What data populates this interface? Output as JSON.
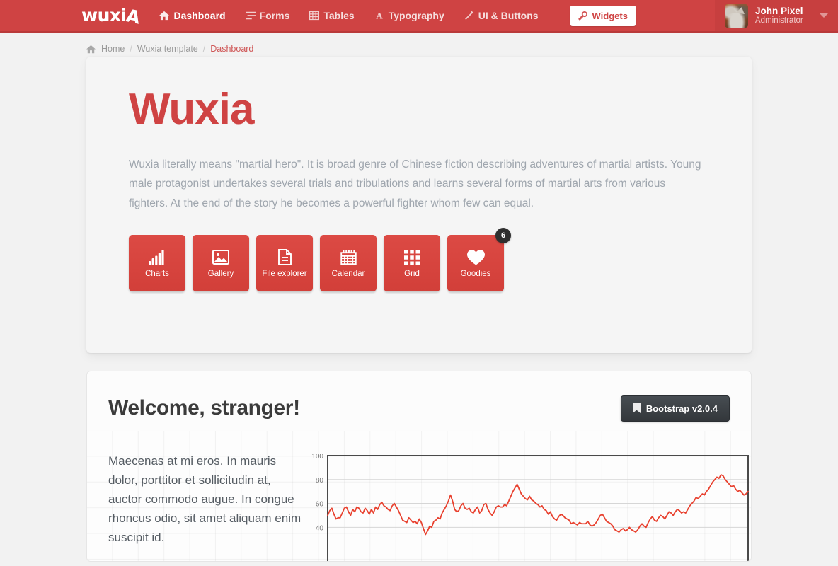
{
  "colors": {
    "brand_red": "#cf4343",
    "tile_red": "#d9453f",
    "page_bg": "#f2f2f2",
    "panel_bg": "#f5f5f5",
    "dark_btn": "#3a3f44",
    "chart_line": "#e8412f",
    "muted_text": "#9fa6ae"
  },
  "navbar": {
    "brand": "wuxia",
    "items": [
      {
        "label": "Dashboard",
        "icon": "home-icon",
        "active": true
      },
      {
        "label": "Forms",
        "icon": "list-icon",
        "active": false
      },
      {
        "label": "Tables",
        "icon": "table-icon",
        "active": false
      },
      {
        "label": "Typography",
        "icon": "font-icon",
        "active": false
      },
      {
        "label": "UI & Buttons",
        "icon": "magic-wand-icon",
        "active": false
      }
    ],
    "widgets_label": "Widgets",
    "widgets_icon": "wrench-icon",
    "user": {
      "name": "John Pixel",
      "role": "Administrator",
      "avatar_alt": "cat-avatar",
      "caret_icon": "caret-down-icon"
    }
  },
  "breadcrumb": {
    "home_icon": "home-icon",
    "items": [
      {
        "label": "Home",
        "current": false
      },
      {
        "label": "Wuxia template",
        "current": false
      },
      {
        "label": "Dashboard",
        "current": true
      }
    ],
    "separator": "/"
  },
  "hero": {
    "title": "Wuxia",
    "paragraph": "Wuxia literally means \"martial hero\". It is broad genre of Chinese fiction describing adventures of martial artists. Young male protagonist undertakes several trials and tribulations and learns several forms of martial arts from various fighters. At the end of the story he becomes a powerful fighter whom few can equal.",
    "tiles": [
      {
        "label": "Charts",
        "icon": "bar-chart-icon",
        "badge": null
      },
      {
        "label": "Gallery",
        "icon": "image-icon",
        "badge": null
      },
      {
        "label": "File explorer",
        "icon": "file-icon",
        "badge": null
      },
      {
        "label": "Calendar",
        "icon": "calendar-icon",
        "badge": null
      },
      {
        "label": "Grid",
        "icon": "grid-icon",
        "badge": null
      },
      {
        "label": "Goodies",
        "icon": "heart-icon",
        "badge": "6"
      }
    ]
  },
  "welcome": {
    "title": "Welcome, stranger!",
    "badge_button": {
      "label": "Bootstrap v2.0.4",
      "icon": "bookmark-icon"
    },
    "paragraph": "Maecenas at mi eros. In mauris dolor, porttitor et sollicitudin at, auctor commodo augue. In congue rhoncus odio, sit amet aliquam enim suscipit id."
  },
  "chart_data": {
    "type": "line",
    "title": "",
    "xlabel": "",
    "ylabel": "",
    "ylim": [
      0,
      100
    ],
    "yticks": [
      40,
      60,
      80,
      100
    ],
    "ytick_labels": [
      "40",
      "60",
      "80",
      "100"
    ],
    "grid": true,
    "legend": false,
    "series": [
      {
        "name": "series-1",
        "color": "#e8412f",
        "values": [
          50,
          54,
          56,
          51,
          47,
          48,
          48,
          52,
          56,
          57,
          53,
          50,
          55,
          53,
          57,
          56,
          53,
          52,
          56,
          54,
          51,
          55,
          52,
          57,
          55,
          59,
          61,
          58,
          57,
          55,
          54,
          58,
          60,
          57,
          54,
          50,
          46,
          45,
          44,
          48,
          46,
          44,
          45,
          43,
          47,
          44,
          39,
          34,
          37,
          41,
          40,
          45,
          46,
          48,
          47,
          52,
          55,
          58,
          62,
          67,
          62,
          55,
          53,
          54,
          58,
          60,
          56,
          55,
          56,
          53,
          52,
          55,
          57,
          52,
          54,
          59,
          60,
          55,
          52,
          50,
          53,
          57,
          58,
          57,
          57,
          59,
          58,
          62,
          66,
          70,
          73,
          76,
          72,
          68,
          66,
          64,
          63,
          66,
          63,
          62,
          60,
          59,
          57,
          58,
          55,
          54,
          51,
          53,
          49,
          47,
          46,
          49,
          51,
          50,
          48,
          47,
          46,
          43,
          44,
          43,
          42,
          44,
          43,
          43,
          43,
          45,
          42,
          41,
          42,
          44,
          47,
          50,
          51,
          48,
          45,
          44,
          43,
          41,
          38,
          37,
          36,
          38,
          39,
          37,
          38,
          40,
          38,
          37,
          36,
          38,
          41,
          43,
          41,
          40,
          44,
          47,
          49,
          46,
          45,
          48,
          50,
          49,
          47,
          50,
          53,
          52,
          50,
          53,
          55,
          54,
          52,
          53,
          52,
          55,
          58,
          60,
          62,
          65,
          64,
          66,
          68,
          67,
          70,
          72,
          75,
          78,
          80,
          82,
          81,
          84,
          83,
          80,
          78,
          76,
          74,
          75,
          72,
          70,
          71,
          69,
          67,
          68,
          70
        ]
      }
    ]
  }
}
